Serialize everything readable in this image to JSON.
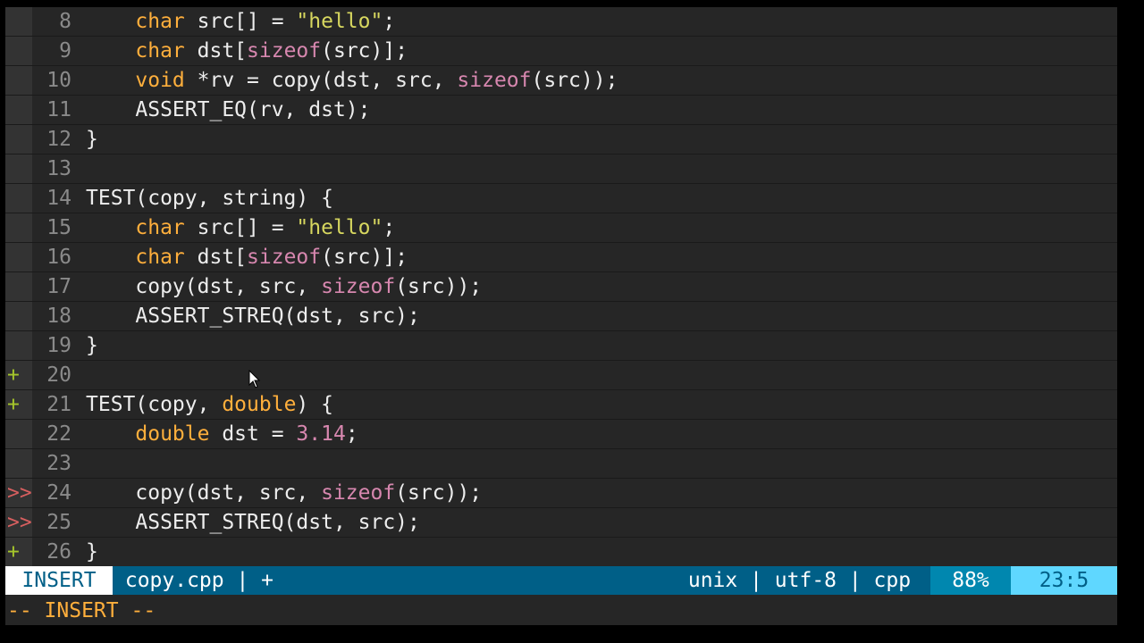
{
  "editor": {
    "lines": [
      {
        "sign": "",
        "sign_type": "",
        "num": "8",
        "tokens": [
          [
            "",
            "    "
          ],
          [
            "kw",
            "char"
          ],
          [
            "",
            " src[] = "
          ],
          [
            "str",
            "\"hello\""
          ],
          [
            "",
            ";"
          ]
        ]
      },
      {
        "sign": "",
        "sign_type": "",
        "num": "9",
        "tokens": [
          [
            "",
            "    "
          ],
          [
            "kw",
            "char"
          ],
          [
            "",
            " dst["
          ],
          [
            "fn",
            "sizeof"
          ],
          [
            "",
            "(src)];"
          ]
        ]
      },
      {
        "sign": "",
        "sign_type": "",
        "num": "10",
        "tokens": [
          [
            "",
            "    "
          ],
          [
            "kw",
            "void"
          ],
          [
            "",
            " *rv = copy(dst, src, "
          ],
          [
            "fn",
            "sizeof"
          ],
          [
            "",
            "(src));"
          ]
        ]
      },
      {
        "sign": "",
        "sign_type": "",
        "num": "11",
        "tokens": [
          [
            "",
            "    ASSERT_EQ(rv, dst);"
          ]
        ]
      },
      {
        "sign": "",
        "sign_type": "",
        "num": "12",
        "tokens": [
          [
            "",
            "}"
          ]
        ]
      },
      {
        "sign": "",
        "sign_type": "",
        "num": "13",
        "tokens": []
      },
      {
        "sign": "",
        "sign_type": "",
        "num": "14",
        "tokens": [
          [
            "",
            "TEST(copy, string) {"
          ]
        ]
      },
      {
        "sign": "",
        "sign_type": "",
        "num": "15",
        "tokens": [
          [
            "",
            "    "
          ],
          [
            "kw",
            "char"
          ],
          [
            "",
            " src[] = "
          ],
          [
            "str",
            "\"hello\""
          ],
          [
            "",
            ";"
          ]
        ]
      },
      {
        "sign": "",
        "sign_type": "",
        "num": "16",
        "tokens": [
          [
            "",
            "    "
          ],
          [
            "kw",
            "char"
          ],
          [
            "",
            " dst["
          ],
          [
            "fn",
            "sizeof"
          ],
          [
            "",
            "(src)];"
          ]
        ]
      },
      {
        "sign": "",
        "sign_type": "",
        "num": "17",
        "tokens": [
          [
            "",
            "    copy(dst, src, "
          ],
          [
            "fn",
            "sizeof"
          ],
          [
            "",
            "(src));"
          ]
        ]
      },
      {
        "sign": "",
        "sign_type": "",
        "num": "18",
        "tokens": [
          [
            "",
            "    ASSERT_STREQ(dst, src);"
          ]
        ]
      },
      {
        "sign": "",
        "sign_type": "",
        "num": "19",
        "tokens": [
          [
            "",
            "}"
          ]
        ]
      },
      {
        "sign": "+",
        "sign_type": "add",
        "num": "20",
        "tokens": []
      },
      {
        "sign": "+",
        "sign_type": "add",
        "num": "21",
        "tokens": [
          [
            "",
            "TEST(copy, "
          ],
          [
            "kw",
            "double"
          ],
          [
            "",
            ") {"
          ]
        ]
      },
      {
        "sign": "",
        "sign_type": "",
        "num": "22",
        "tokens": [
          [
            "",
            "    "
          ],
          [
            "kw",
            "double"
          ],
          [
            "",
            " dst = "
          ],
          [
            "num",
            "3.14"
          ],
          [
            "",
            ";"
          ]
        ]
      },
      {
        "sign": "",
        "sign_type": "",
        "num": "23",
        "tokens": []
      },
      {
        "sign": ">>",
        "sign_type": "change",
        "num": "24",
        "tokens": [
          [
            "",
            "    copy(dst, src, "
          ],
          [
            "fn",
            "sizeof"
          ],
          [
            "",
            "(src));"
          ]
        ]
      },
      {
        "sign": ">>",
        "sign_type": "change",
        "num": "25",
        "tokens": [
          [
            "",
            "    ASSERT_STREQ(dst, src);"
          ]
        ]
      },
      {
        "sign": "+",
        "sign_type": "add",
        "num": "26",
        "tokens": [
          [
            "",
            "}"
          ]
        ]
      }
    ]
  },
  "statusline": {
    "mode": "INSERT",
    "file": " copy.cpp | +",
    "fileformat": " unix | utf-8 | cpp",
    "percent": "88%",
    "position": "23:5"
  },
  "cmdline": {
    "text": "-- INSERT --"
  },
  "colors": {
    "background": "#262626",
    "keyword": "#ffaf3c",
    "function": "#d787af",
    "string": "#d7d75f",
    "sign_add": "#a6c62b",
    "sign_change": "#d75f5f",
    "statusline": "#005f87"
  }
}
